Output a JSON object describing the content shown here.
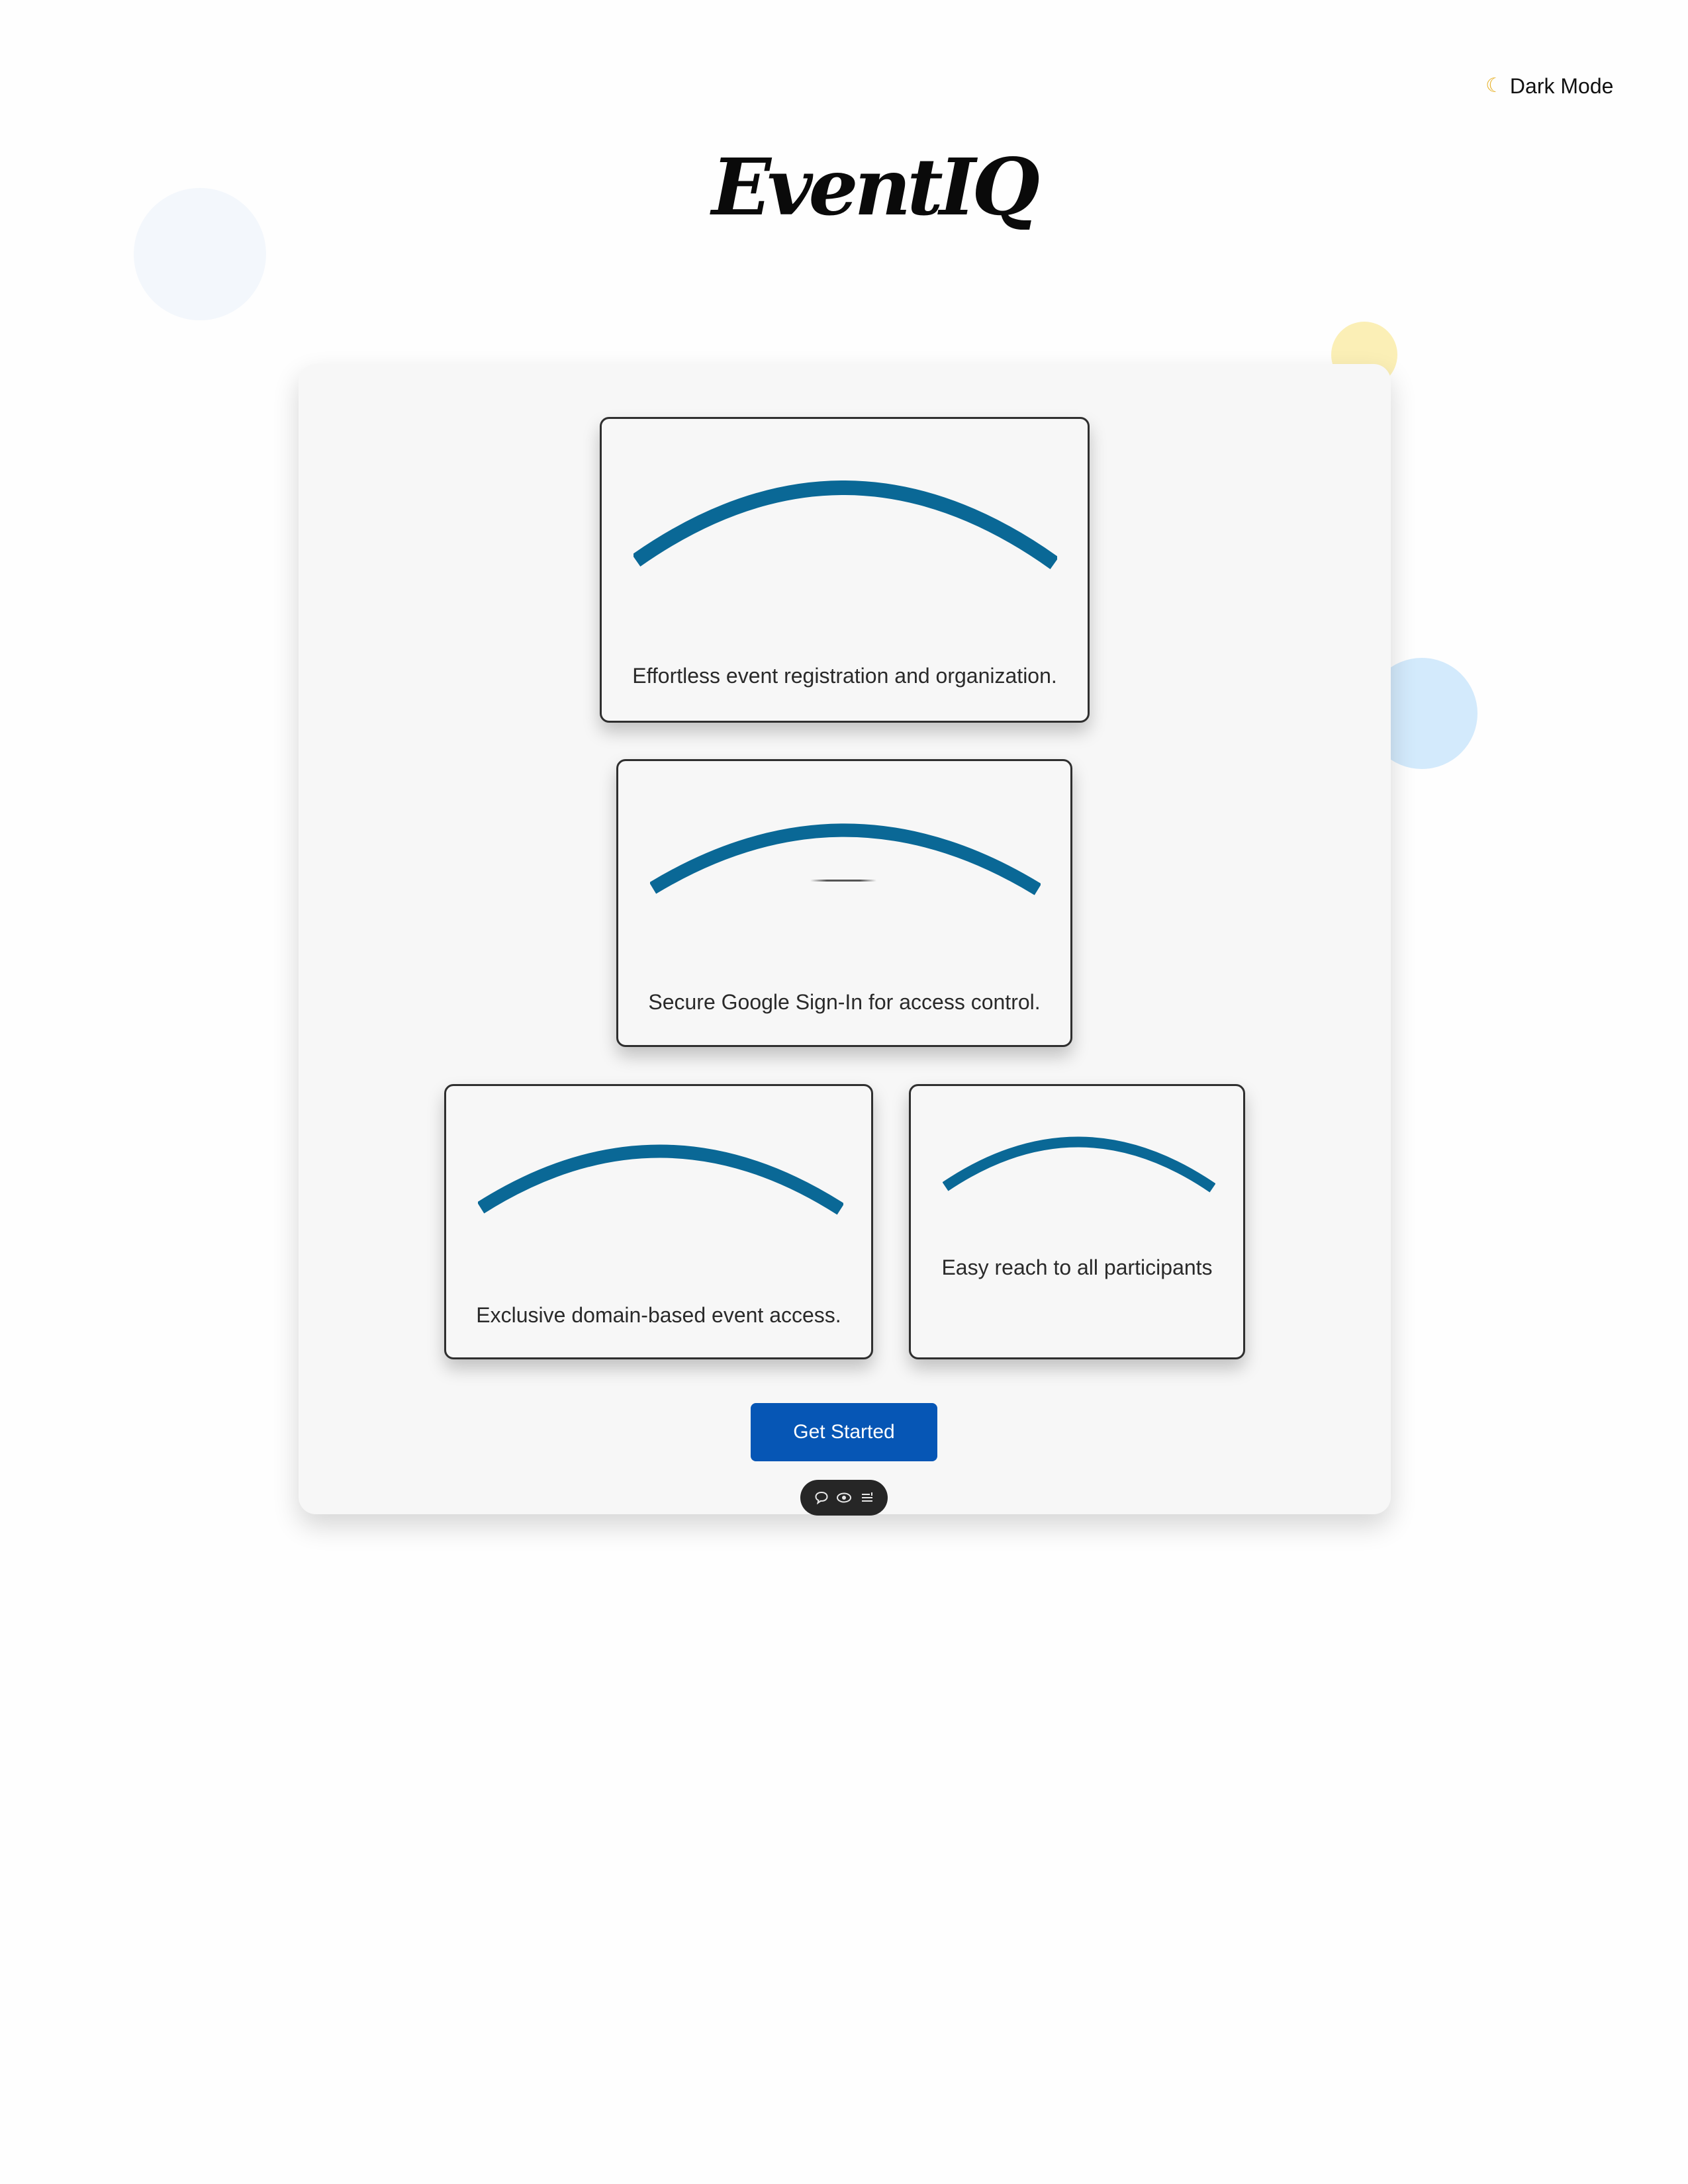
{
  "header": {
    "dark_mode_label": "Dark Mode",
    "dark_mode_icon": "moon-icon"
  },
  "brand": {
    "logo_text": "EventIQ"
  },
  "features": [
    {
      "text": "Effortless event registration and organization."
    },
    {
      "text": "Secure Google Sign-In for access control."
    },
    {
      "text": "Exclusive domain-based event access."
    },
    {
      "text": "Easy reach to all participants"
    }
  ],
  "cta": {
    "label": "Get Started"
  },
  "toolbar": {
    "icons": [
      "comment-icon",
      "eye-icon",
      "list-icon"
    ]
  },
  "colors": {
    "accent": "#0656b5",
    "arc": "#0a6896",
    "panel": "#f7f7f7"
  }
}
